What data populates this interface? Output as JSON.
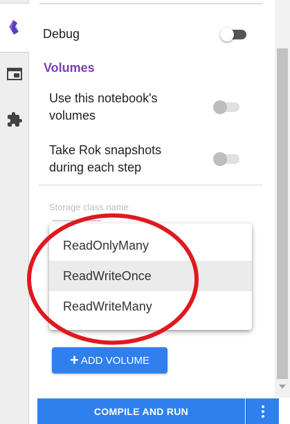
{
  "rail": {
    "tabs": [
      {
        "icon": "kubeflow-logo-icon",
        "active": true
      },
      {
        "icon": "window-icon",
        "active": false
      },
      {
        "icon": "puzzle-piece-icon",
        "active": false
      }
    ]
  },
  "settings": {
    "debug_label": "Debug",
    "debug_enabled": true
  },
  "volumes": {
    "title": "Volumes",
    "use_notebook_volumes_label": "Use this notebook's volumes",
    "use_notebook_volumes_enabled": false,
    "rok_snapshots_label": "Take Rok snapshots during each step",
    "rok_snapshots_enabled": false,
    "storage_class_label": "Storage class name"
  },
  "access_mode_menu": {
    "options": [
      "ReadOnlyMany",
      "ReadWriteOnce",
      "ReadWriteMany"
    ],
    "highlighted": "ReadWriteOnce"
  },
  "add_volume_button": {
    "plus": "+",
    "label": "ADD VOLUME"
  },
  "compile_button": {
    "label": "COMPILE AND RUN"
  },
  "colors": {
    "accent_purple": "#7b3fb8",
    "button_blue": "#2f80ed",
    "annotation_red": "#e0191f"
  }
}
